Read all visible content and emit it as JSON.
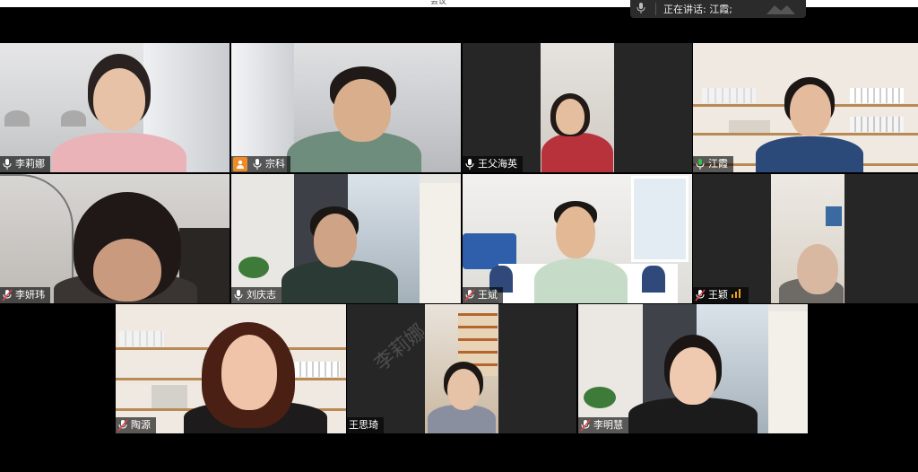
{
  "window": {
    "title": "会议"
  },
  "speaking_banner": {
    "text": "正在讲话: 江霞;"
  },
  "participants": [
    {
      "name": "李莉娜",
      "mic": "on"
    },
    {
      "name": "宗科",
      "mic": "on",
      "host": true
    },
    {
      "name": "王父海英",
      "mic": "on"
    },
    {
      "name": "江霞",
      "mic": "active"
    },
    {
      "name": "李妍玮",
      "mic": "muted"
    },
    {
      "name": "刘庆志",
      "mic": "on"
    },
    {
      "name": "王斌",
      "mic": "muted"
    },
    {
      "name": "王颖",
      "mic": "muted",
      "signal": "weak"
    },
    {
      "name": "陶源",
      "mic": "muted"
    },
    {
      "name": "王思琦",
      "mic": "none"
    },
    {
      "name": "李明慧",
      "mic": "muted"
    }
  ],
  "watermark": "李莉娜",
  "colors": {
    "host": "#f08a24",
    "muted": "#e0474c",
    "active": "#2fbf4a",
    "label_bg": "#000000"
  }
}
